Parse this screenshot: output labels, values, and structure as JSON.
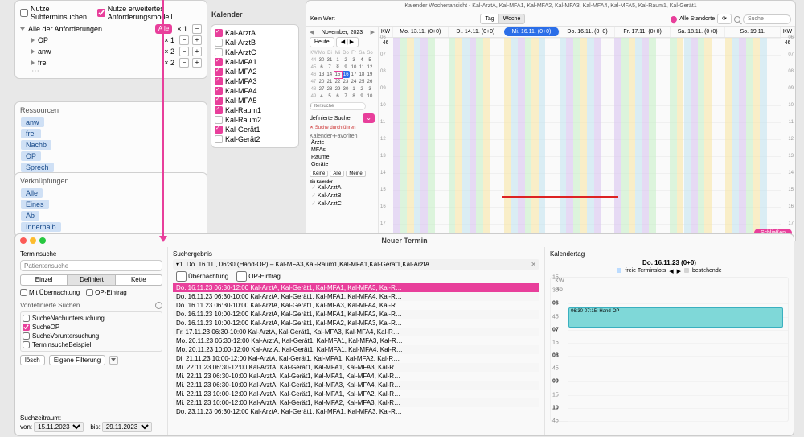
{
  "requirements": {
    "check_sub": "Nutze Subterminsuchen",
    "check_ext": "Nutze erweitertes Anforderungsmodell",
    "title": "Alle der Anforderungen",
    "all": "Alle",
    "mult1": "× 1",
    "items": [
      {
        "name": "OP",
        "mult": "× 1"
      },
      {
        "name": "anw",
        "mult": "× 2"
      },
      {
        "name": "frei",
        "mult": "× 2"
      }
    ]
  },
  "ressourcen": {
    "title": "Ressourcen",
    "chips": [
      "anw",
      "frei",
      "Nachb",
      "OP",
      "Sprech"
    ]
  },
  "verkn": {
    "title": "Verknüpfungen",
    "chips": [
      "Alle",
      "Eines",
      "Ab",
      "Innerhalb"
    ]
  },
  "kalender": {
    "title": "Kalender",
    "items": [
      {
        "n": "Kal-ArztA",
        "on": true
      },
      {
        "n": "Kal-ArztB",
        "on": false
      },
      {
        "n": "Kal-ArztC",
        "on": false
      },
      {
        "n": "Kal-MFA1",
        "on": true
      },
      {
        "n": "Kal-MFA2",
        "on": true
      },
      {
        "n": "Kal-MFA3",
        "on": true
      },
      {
        "n": "Kal-MFA4",
        "on": true
      },
      {
        "n": "Kal-MFA5",
        "on": true
      },
      {
        "n": "Kal-Raum1",
        "on": true
      },
      {
        "n": "Kal-Raum2",
        "on": false
      },
      {
        "n": "Kal-Gerät1",
        "on": true
      },
      {
        "n": "Kal-Gerät2",
        "on": false
      }
    ]
  },
  "week": {
    "title": "Kalender Wochenansicht - Kal-ArztA, Kal-MFA1, Kal-MFA2, Kal-MFA3, Kal-MFA4, Kal-MFA5, Kal-Raum1, Kal-Gerät1",
    "kein_wert": "Kein Wert",
    "tag": "Tag",
    "woche": "Woche",
    "alle_standorte": "Alle Standorte",
    "search_ph": "Suche",
    "close": "Schließen",
    "nav_month": "November, 2023",
    "heute": "Heute",
    "tri": "◀  |  ▶",
    "kw_l": "KW\n46",
    "kw_r": "KW\n46",
    "days": [
      "Mo. 13.11. (0+0)",
      "Di. 14.11. (0+0)",
      "Mi. 16.11. (0+0)",
      "Do. 16.11. (0+0)",
      "Fr. 17.11. (0+0)",
      "Sa. 18.11. (0+0)",
      "So. 19.11."
    ],
    "side": {
      "filter_ph": "Filtersuche",
      "def_suche": "definierte Suche",
      "suche_durch": "Suche durchführen",
      "fav": "Kalender-Favoriten",
      "fav_items": [
        "Ärzte",
        "MFAs",
        "Räume",
        "Geräte"
      ],
      "keine": "Keine",
      "alle": "Alle",
      "meine": "Meine",
      "ein": "Ein Kalender",
      "kal_items": [
        "Kal-ArztA",
        "Kal-ArztB",
        "Kal-ArztC"
      ]
    },
    "minical": {
      "dow": [
        "KW",
        "Mo",
        "Di",
        "Mi",
        "Do",
        "Fr",
        "Sa",
        "So"
      ],
      "rows": [
        [
          "44",
          "30",
          "31",
          "1",
          "2",
          "3",
          "4",
          "5"
        ],
        [
          "45",
          "6",
          "7",
          "8",
          "9",
          "10",
          "11",
          "12"
        ],
        [
          "46",
          "13",
          "14",
          "15",
          "16",
          "17",
          "18",
          "19"
        ],
        [
          "47",
          "20",
          "21",
          "22",
          "23",
          "24",
          "25",
          "26"
        ],
        [
          "48",
          "27",
          "28",
          "29",
          "30",
          "1",
          "2",
          "3"
        ],
        [
          "49",
          "4",
          "5",
          "6",
          "7",
          "8",
          "9",
          "10"
        ]
      ],
      "today_idx": [
        2,
        4
      ],
      "sel_idx": [
        2,
        3
      ]
    }
  },
  "appt": {
    "title": "Neuer Termin",
    "left": {
      "h": "Terminsuche",
      "search_ph": "Patientensuche",
      "seg": [
        "Einzel",
        "Definiert",
        "Kette"
      ],
      "seg_active": 1,
      "chk1": "Mit Übernachtung",
      "chk2": "OP-Eintrag",
      "predef_h": "Vordefinierte Suchen",
      "predef": [
        {
          "n": "SucheNachuntersuchung",
          "on": false
        },
        {
          "n": "SucheOP",
          "on": true
        },
        {
          "n": "SucheVoruntersuchung",
          "on": false
        },
        {
          "n": "TerminsucheBeispiel",
          "on": false
        }
      ],
      "loesch": "lösch",
      "eigene": "Eigene Filterung",
      "zeitraum": "Suchzeitraum:",
      "von": "von:",
      "von_v": "15.11.2023",
      "bis": "bis:",
      "bis_v": "29.11.2023"
    },
    "mid": {
      "h": "Suchergebnis",
      "res_h": "1. Do. 16.11., 06:30 (Hand-OP) – Kal-MFA3,Kal-Raum1,Kal-MFA1,Kal-Gerät1,Kal-ArztA",
      "uebern": "Übernachtung",
      "opE": "OP-Eintrag",
      "rows": [
        "Do.  16.11.23   06:30-12:00 Kal-ArztA, Kal-Gerät1, Kal-MFA1, Kal-MFA3, Kal-R…",
        "Do.  16.11.23   06:30-10:00 Kal-ArztA, Kal-Gerät1, Kal-MFA1, Kal-MFA4, Kal-R…",
        "Do.  16.11.23   06:30-10:00 Kal-ArztA, Kal-Gerät1, Kal-MFA3, Kal-MFA4, Kal-R…",
        "Do.  16.11.23   10:00-12:00 Kal-ArztA, Kal-Gerät1, Kal-MFA1, Kal-MFA2, Kal-R…",
        "Do.  16.11.23   10:00-12:00 Kal-ArztA, Kal-Gerät1, Kal-MFA2, Kal-MFA3, Kal-R…",
        "Fr.  17.11.23   06:30-10:00 Kal-ArztA, Kal-Gerät1, Kal-MFA3, Kal-MFA4, Kal-R…",
        "Mo.  20.11.23   06:30-12:00 Kal-ArztA, Kal-Gerät1, Kal-MFA1, Kal-MFA3, Kal-R…",
        "Mo.  20.11.23   10:00-12:00 Kal-ArztA, Kal-Gerät1, Kal-MFA1, Kal-MFA4, Kal-R…",
        "Di.  21.11.23   10:00-12:00 Kal-ArztA, Kal-Gerät1, Kal-MFA1, Kal-MFA2, Kal-R…",
        "Mi.  22.11.23   06:30-12:00 Kal-ArztA, Kal-Gerät1, Kal-MFA1, Kal-MFA3, Kal-R…",
        "Mi.  22.11.23   06:30-10:00 Kal-ArztA, Kal-Gerät1, Kal-MFA1, Kal-MFA4, Kal-R…",
        "Mi.  22.11.23   06:30-10:00 Kal-ArztA, Kal-Gerät1, Kal-MFA3, Kal-MFA4, Kal-R…",
        "Mi.  22.11.23   10:00-12:00 Kal-ArztA, Kal-Gerät1, Kal-MFA1, Kal-MFA2, Kal-R…",
        "Mi.  22.11.23   10:00-12:00 Kal-ArztA, Kal-Gerät1, Kal-MFA2, Kal-MFA3, Kal-R…",
        "Do.  23.11.23   06:30-12:00 Kal-ArztA, Kal-Gerät1, Kal-MFA1, Kal-MFA3, Kal-R…"
      ]
    },
    "right": {
      "h": "Kalendertag",
      "date": "Do. 16.11.23 (0+0)",
      "kw": "KW\n46",
      "freie": "freie Terminslots",
      "best": "bestehende",
      "tri_l": "◀",
      "tri_r": "▶",
      "block": "06:30-07:15: Hand-OP"
    }
  }
}
